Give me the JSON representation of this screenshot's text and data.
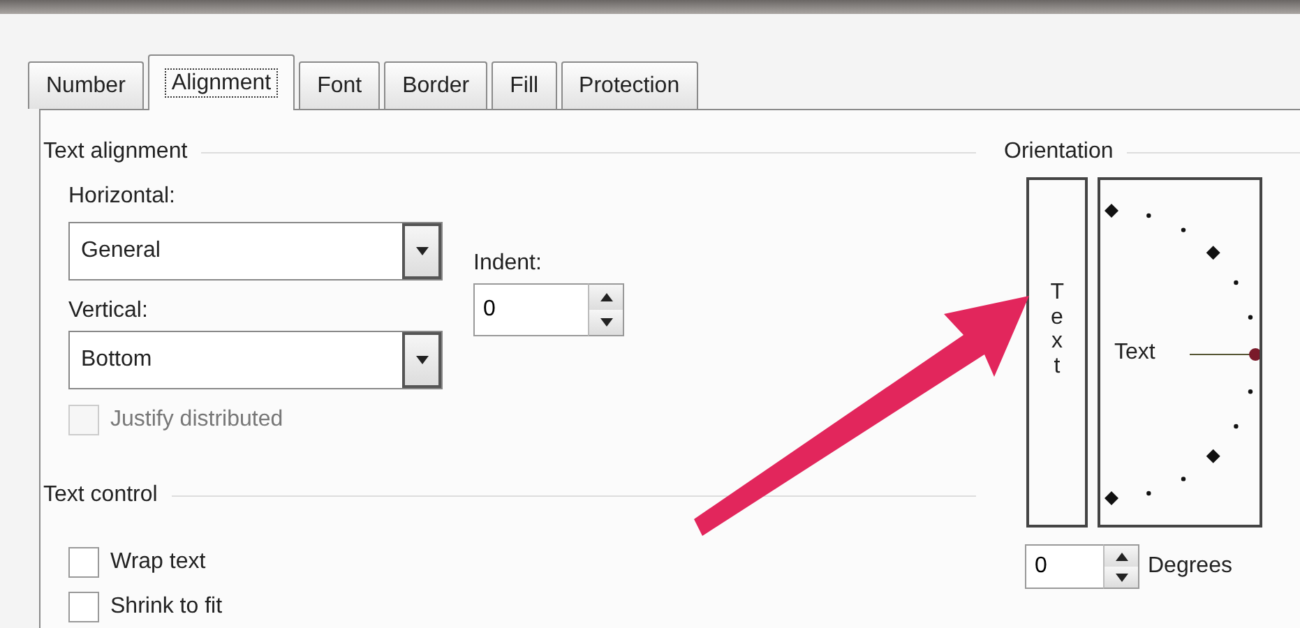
{
  "tabs": [
    {
      "label": "Number",
      "selected": false
    },
    {
      "label": "Alignment",
      "selected": true
    },
    {
      "label": "Font",
      "selected": false
    },
    {
      "label": "Border",
      "selected": false
    },
    {
      "label": "Fill",
      "selected": false
    },
    {
      "label": "Protection",
      "selected": false
    }
  ],
  "text_alignment": {
    "title": "Text alignment",
    "horizontal": {
      "label": "Horizontal:",
      "value": "General"
    },
    "vertical": {
      "label": "Vertical:",
      "value": "Bottom"
    },
    "indent": {
      "label": "Indent:",
      "value": "0"
    },
    "justify_distributed": {
      "label": "Justify distributed",
      "checked": false,
      "disabled": true
    }
  },
  "text_control": {
    "title": "Text control",
    "options": [
      {
        "label": "Wrap text",
        "checked": false,
        "disabled": false
      },
      {
        "label": "Shrink to fit",
        "checked": false,
        "disabled": false
      }
    ]
  },
  "orientation": {
    "title": "Orientation",
    "vertical_text": "Text",
    "dial_text": "Text",
    "degrees": {
      "value": "0",
      "label": "Degrees"
    }
  }
}
